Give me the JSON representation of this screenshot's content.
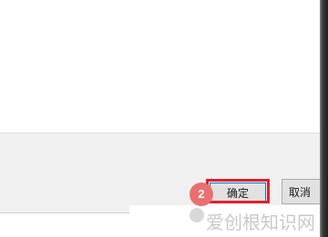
{
  "dialog": {
    "ok_label": "确定",
    "cancel_label": "取消"
  },
  "annotation": {
    "step_number": "2",
    "highlight_color": "#e0202a",
    "badge_color": "#ea7070"
  },
  "watermark": {
    "text": "爱创根知识网"
  }
}
